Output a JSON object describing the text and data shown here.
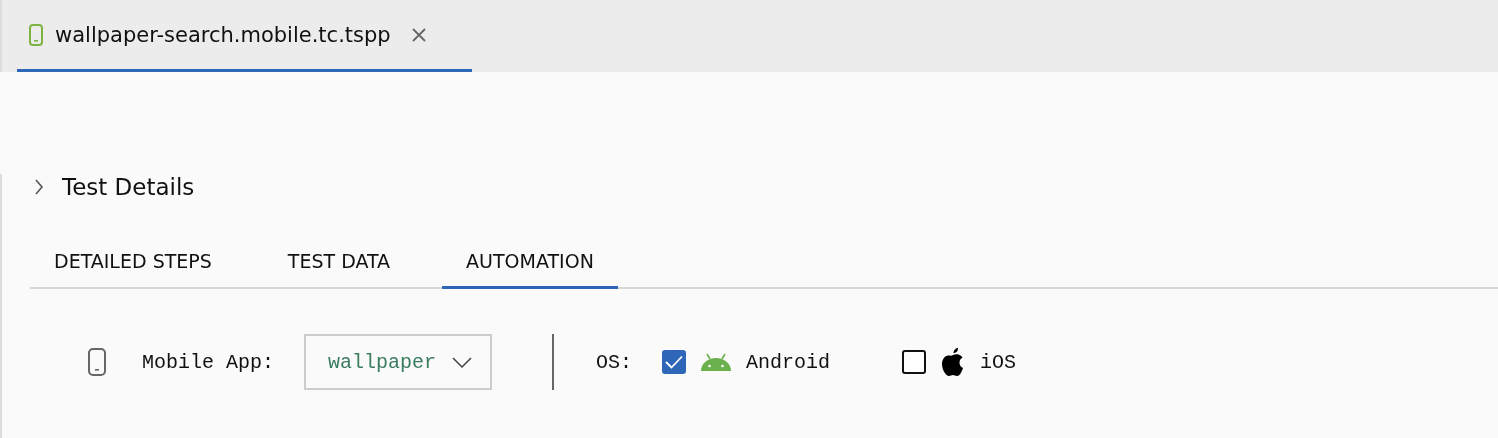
{
  "editor_tabs": [
    {
      "label": "wallpaper-search.mobile.tc.tspp",
      "selected": true
    }
  ],
  "section": {
    "title": "Test Details",
    "expanded": false
  },
  "tabs": [
    {
      "label": "DETAILED STEPS",
      "selected": false
    },
    {
      "label": "TEST DATA",
      "selected": false
    },
    {
      "label": "AUTOMATION",
      "selected": true
    }
  ],
  "mobile_app": {
    "label": "Mobile App:",
    "value": "wallpaper"
  },
  "os": {
    "label": "OS:",
    "options": [
      {
        "kind": "android",
        "label": "Android",
        "checked": true
      },
      {
        "kind": "ios",
        "label": "iOS",
        "checked": false
      }
    ]
  }
}
